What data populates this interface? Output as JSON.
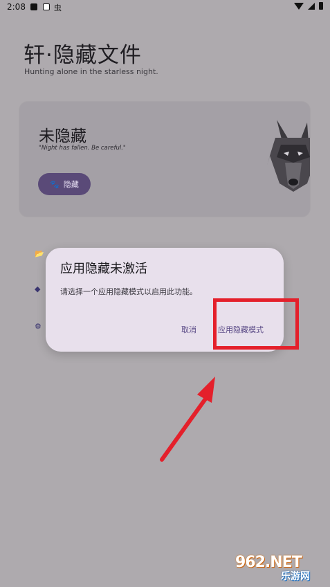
{
  "status_bar": {
    "time": "2:08",
    "bug_glyph": "虫",
    "icons": [
      "notification-icon",
      "photo-icon",
      "bug-icon",
      "wifi-icon",
      "signal-icon",
      "battery-icon"
    ]
  },
  "header": {
    "title": "轩·隐藏文件",
    "subtitle": "Hunting alone in the starless night."
  },
  "status_card": {
    "title": "未隐藏",
    "quote": "\"Night has fallen. Be careful.\"",
    "button_label": "隐藏",
    "button_icon": "paw-icon",
    "image": "wolf-illustration"
  },
  "list_icons": [
    "folder-icon",
    "box-icon",
    "gear-icon"
  ],
  "dialog": {
    "title": "应用隐藏未激活",
    "message": "请选择一个应用隐藏模式以启用此功能。",
    "cancel_label": "取消",
    "confirm_label": "应用隐藏模式"
  },
  "annotations": {
    "highlight_color": "#e4202b"
  },
  "watermark": {
    "main": "962.NET",
    "sub": "乐游网"
  },
  "colors": {
    "background": "#aeaaae",
    "card": "#a4a0a6",
    "button": "#5a4a78",
    "dialog": "#e8e0ec",
    "accent_text": "#5a4a86"
  }
}
